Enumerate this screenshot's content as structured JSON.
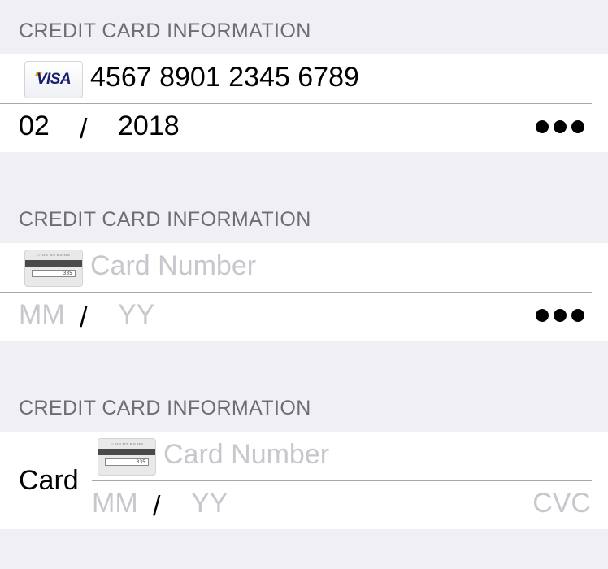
{
  "section1": {
    "header": "CREDIT CARD INFORMATION",
    "card_icon": "visa-card-icon",
    "card_brand": "VISA",
    "card_number": "4567 8901 2345 6789",
    "expiry_month": "02",
    "expiry_separator": "/",
    "expiry_year": "2018",
    "cvc_masked_icon": "masked-dots-icon"
  },
  "section2": {
    "header": "CREDIT CARD INFORMATION",
    "card_icon": "card-back-icon",
    "card_number_placeholder": "Card Number",
    "month_placeholder": "MM",
    "expiry_separator": "/",
    "year_placeholder": "YY",
    "cvc_masked_icon": "masked-dots-icon"
  },
  "section3": {
    "header": "CREDIT CARD INFORMATION",
    "row_label": "Card",
    "card_icon": "card-back-icon",
    "card_number_placeholder": "Card Number",
    "month_placeholder": "MM",
    "expiry_separator": "/",
    "year_placeholder": "YY",
    "cvc_placeholder": "CVC"
  },
  "icon_card_back": {
    "signature_text": "// 1234 5678 9012 3456",
    "cvc_digits": "335"
  },
  "colors": {
    "background": "#efeff4",
    "header_text": "#6d6d72",
    "placeholder": "#c7c7cd",
    "separator": "#a8a8ad"
  }
}
